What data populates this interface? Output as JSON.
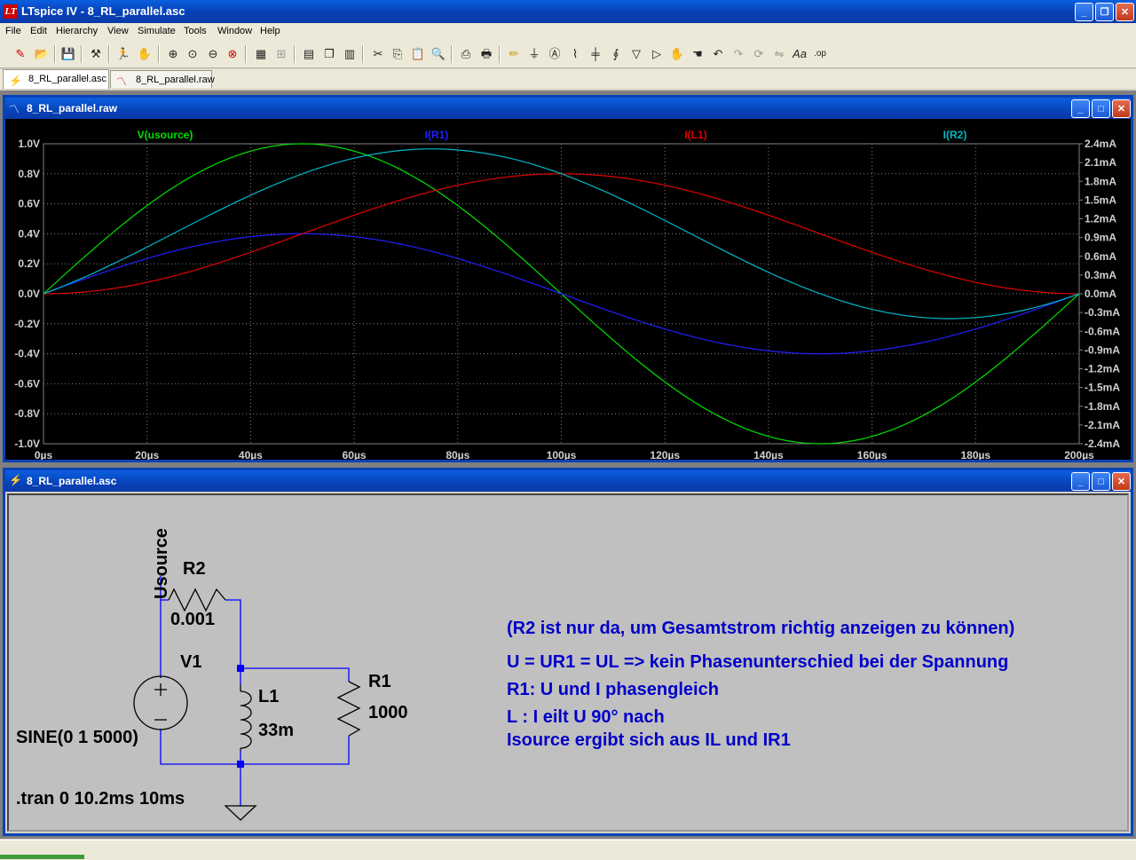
{
  "window": {
    "title": "LTspice IV - 8_RL_parallel.asc",
    "icon_label": "LT"
  },
  "menu": [
    "File",
    "Edit",
    "Hierarchy",
    "View",
    "Simulate",
    "Tools",
    "Window",
    "Help"
  ],
  "tabs": [
    {
      "label": "8_RL_parallel.asc",
      "active": true
    },
    {
      "label": "8_RL_parallel.raw",
      "active": false
    }
  ],
  "plot_window": {
    "title": "8_RL_parallel.raw"
  },
  "schematic_window": {
    "title": "8_RL_parallel.asc"
  },
  "colors": {
    "green": "#00e000",
    "blue": "#2020ff",
    "red": "#e00000",
    "cyan": "#00b8c8",
    "wire": "#0000ff",
    "text_blue": "#0000c8"
  },
  "chart_data": {
    "type": "line",
    "x": {
      "min": 0,
      "max": 200,
      "unit": "µs",
      "ticks": [
        "0µs",
        "20µs",
        "40µs",
        "60µs",
        "80µs",
        "100µs",
        "120µs",
        "140µs",
        "160µs",
        "180µs",
        "200µs"
      ]
    },
    "y_left": {
      "min": -1.0,
      "max": 1.0,
      "ticks": [
        "1.0V",
        "0.8V",
        "0.6V",
        "0.4V",
        "0.2V",
        "0.0V",
        "-0.2V",
        "-0.4V",
        "-0.6V",
        "-0.8V",
        "-1.0V"
      ]
    },
    "y_right": {
      "min": -2.4,
      "max": 2.4,
      "ticks": [
        "2.4mA",
        "2.1mA",
        "1.8mA",
        "1.5mA",
        "1.2mA",
        "0.9mA",
        "0.6mA",
        "0.3mA",
        "0.0mA",
        "-0.3mA",
        "-0.6mA",
        "-0.9mA",
        "-1.2mA",
        "-1.5mA",
        "-1.8mA",
        "-2.1mA",
        "-2.4mA"
      ]
    },
    "grid": true,
    "series": [
      {
        "name": "V(usource)",
        "color": "#00e000",
        "axis": "left",
        "kind": "sin",
        "amp": 1.0,
        "phase_deg": 0,
        "offset": 0
      },
      {
        "name": "I(R1)",
        "color": "#2020ff",
        "axis": "right",
        "kind": "sin",
        "amp": 0.96,
        "phase_deg": 0,
        "offset": 0
      },
      {
        "name": "I(L1)",
        "color": "#e00000",
        "axis": "right",
        "kind": "cos",
        "amp": 0.96,
        "phase_deg": 0,
        "offset": 0.96
      },
      {
        "name": "I(R2)",
        "color": "#00b8c8",
        "axis": "right",
        "kind": "sum",
        "amp": 0,
        "phase_deg": 0,
        "offset": 0
      }
    ]
  },
  "schematic": {
    "labels": {
      "usource": "Usource",
      "r2_name": "R2",
      "r2_value": "0.001",
      "v1_name": "V1",
      "l1_name": "L1",
      "l1_value": "33m",
      "r1_name": "R1",
      "r1_value": "1000",
      "source_spec": "SINE(0 1 5000)",
      "tran": ".tran 0 10.2ms 10ms"
    },
    "notes": [
      "(R2 ist nur da, um Gesamtstrom richtig anzeigen zu können)",
      "U = UR1 = UL => kein Phasenunterschied bei der Spannung",
      "R1: U und I phasengleich",
      "L : I eilt U 90° nach",
      "Isource ergibt sich aus IL und IR1"
    ]
  }
}
